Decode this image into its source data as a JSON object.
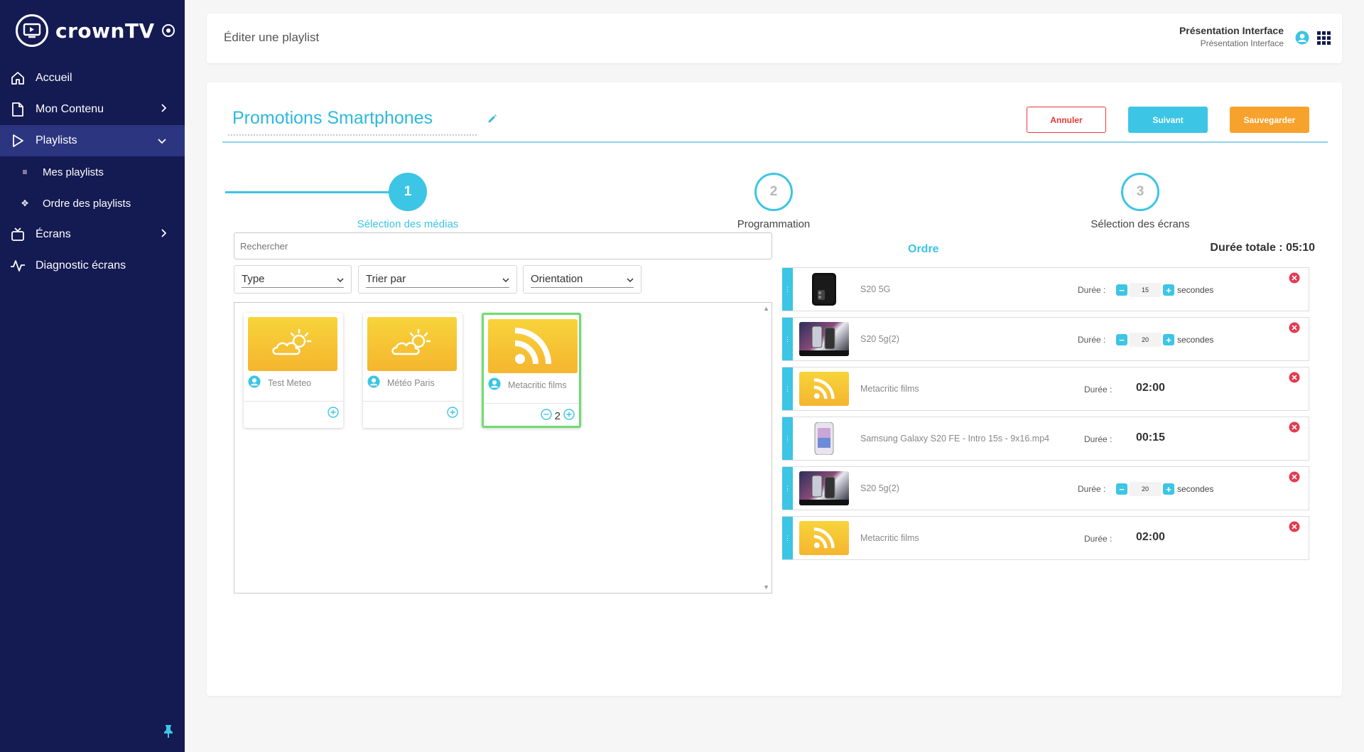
{
  "brand": {
    "name": "crownTV"
  },
  "sidebar": {
    "items": [
      {
        "label": "Accueil",
        "icon": "home-icon"
      },
      {
        "label": "Mon Contenu",
        "icon": "document-icon"
      },
      {
        "label": "Playlists",
        "icon": "play-icon"
      },
      {
        "label": "Écrans",
        "icon": "tv-icon"
      },
      {
        "label": "Diagnostic écrans",
        "icon": "pulse-icon"
      }
    ],
    "subitems": [
      {
        "label": "Mes playlists",
        "icon": "list-icon"
      },
      {
        "label": "Ordre des playlists",
        "icon": "arrows-icon"
      }
    ]
  },
  "topbar": {
    "title": "Éditer une playlist",
    "user_name": "Présentation Interface",
    "user_sub": "Présentation Interface"
  },
  "playlist": {
    "title": "Promotions Smartphones"
  },
  "buttons": {
    "cancel": "Annuler",
    "next": "Suivant",
    "save": "Sauvegarder"
  },
  "steps": [
    {
      "number": "1",
      "label": "Sélection des médias",
      "state": "active"
    },
    {
      "number": "2",
      "label": "Programmation",
      "state": "todo"
    },
    {
      "number": "3",
      "label": "Sélection des écrans",
      "state": "todo"
    }
  ],
  "filters": {
    "search_placeholder": "Rechercher",
    "type": "Type",
    "sort": "Trier par",
    "orientation": "Orientation"
  },
  "media": [
    {
      "name": "Test Meteo",
      "kind": "weather",
      "count": ""
    },
    {
      "name": "Météo Paris",
      "kind": "weather",
      "count": ""
    },
    {
      "name": "Metacritic films",
      "kind": "rss",
      "count": "2",
      "selected": true
    }
  ],
  "order": {
    "title": "Ordre",
    "total": "Durée totale : 05:10",
    "duration_label": "Durée :",
    "unit": "secondes",
    "rows": [
      {
        "name": "S20 5G",
        "thumb": "phone-dark",
        "editable": true,
        "value": "15"
      },
      {
        "name": "S20 5g(2)",
        "thumb": "phones",
        "editable": true,
        "value": "20"
      },
      {
        "name": "Metacritic films",
        "thumb": "rss",
        "editable": false,
        "value": "02:00"
      },
      {
        "name": "Samsung Galaxy S20 FE - Intro 15s - 9x16.mp4",
        "thumb": "phone-light",
        "editable": false,
        "value": "00:15"
      },
      {
        "name": "S20 5g(2)",
        "thumb": "phones",
        "editable": true,
        "value": "20"
      },
      {
        "name": "Metacritic films",
        "thumb": "rss",
        "editable": false,
        "value": "02:00"
      }
    ]
  },
  "colors": {
    "sidebar": "#141a52",
    "accent": "#3cc5e4",
    "save": "#f7a22d",
    "cancel": "#e53935",
    "media_bg": "#f5c232",
    "selected_border": "#6fdc6f"
  }
}
